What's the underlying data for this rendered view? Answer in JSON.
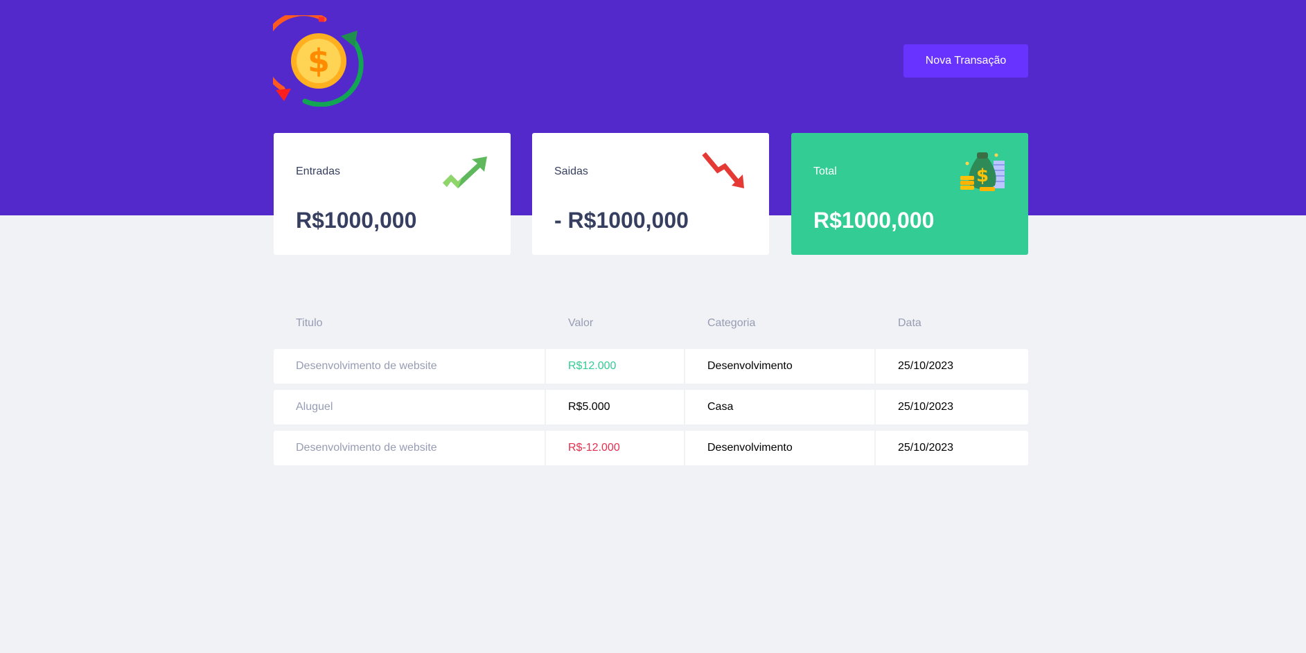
{
  "header": {
    "logo_icon": "currency-exchange-icon",
    "new_transaction_label": "Nova Transação"
  },
  "summary": {
    "income": {
      "label": "Entradas",
      "value": "R$1000,000",
      "icon": "trending-up-arrow-icon"
    },
    "outcome": {
      "label": "Saidas",
      "value": "- R$1000,000",
      "icon": "trending-down-arrow-icon"
    },
    "total": {
      "label": "Total",
      "value": "R$1000,000",
      "icon": "money-bag-icon"
    }
  },
  "table": {
    "headers": [
      "Titulo",
      "Valor",
      "Categoria",
      "Data"
    ],
    "rows": [
      {
        "title": "Desenvolvimento de website",
        "value": "R$12.000",
        "category": "Desenvolvimento",
        "date": "25/10/2023",
        "type": "deposit"
      },
      {
        "title": "Aluguel",
        "value": "R$5.000",
        "category": "Casa",
        "date": "25/10/2023",
        "type": "neutral"
      },
      {
        "title": "Desenvolvimento de website",
        "value": "R$-12.000",
        "category": "Desenvolvimento",
        "date": "25/10/2023",
        "type": "withdraw"
      }
    ]
  },
  "colors": {
    "header_bg": "#5429cc",
    "button_bg": "#6933ff",
    "total_card_bg": "#33cc95",
    "deposit_text": "#33cc95",
    "withdraw_text": "#e52e4d",
    "body_bg": "#f0f2f5"
  }
}
